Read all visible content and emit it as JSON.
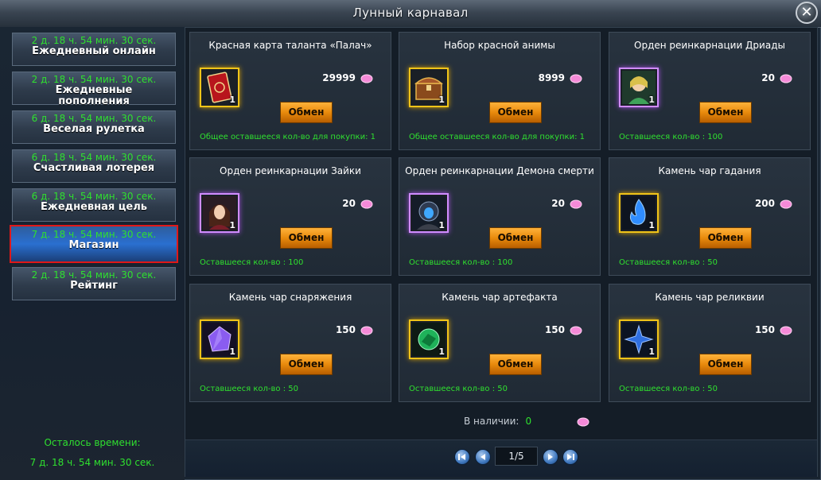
{
  "window": {
    "title": "Лунный карнавал",
    "close_symbol": "✕"
  },
  "sidebar": {
    "tabs": [
      {
        "timer": "2 д. 18 ч. 54 мин. 30 сек.",
        "label": "Ежедневный онлайн"
      },
      {
        "timer": "2 д. 18 ч. 54 мин. 30 сек.",
        "label": "Ежедневные пополнения"
      },
      {
        "timer": "6 д. 18 ч. 54 мин. 30 сек.",
        "label": "Веселая рулетка"
      },
      {
        "timer": "6 д. 18 ч. 54 мин. 30 сек.",
        "label": "Счастливая лотерея"
      },
      {
        "timer": "6 д. 18 ч. 54 мин. 30 сек.",
        "label": "Ежедневная цель"
      },
      {
        "timer": "7 д. 18 ч. 54 мин. 30 сек.",
        "label": "Магазин",
        "active": true
      },
      {
        "timer": "2 д. 18 ч. 54 мин. 30 сек.",
        "label": "Рейтинг"
      }
    ],
    "remaining_label": "Осталось времени:",
    "remaining_value": "7 д. 18 ч. 54 мин. 30 сек."
  },
  "shop": {
    "exchange_label": "Обмен",
    "items": [
      {
        "name": "Красная карта таланта «Палач»",
        "price": "29999",
        "qty": "1",
        "frame": "gold",
        "icon": "red-talent-card-icon",
        "stock": "Общее оставшееся кол-во для покупки: 1"
      },
      {
        "name": "Набор красной анимы",
        "price": "8999",
        "qty": "1",
        "frame": "gold",
        "icon": "treasure-chest-icon",
        "stock": "Общее оставшееся кол-во для покупки: 1"
      },
      {
        "name": "Орден реинкарнации Дриады",
        "price": "20",
        "qty": "1",
        "frame": "purple",
        "icon": "dryad-portrait-icon",
        "stock": "Оставшееся кол-во : 100"
      },
      {
        "name": "Орден реинкарнации Зайки",
        "price": "20",
        "qty": "1",
        "frame": "purple",
        "icon": "bunny-portrait-icon",
        "stock": "Оставшееся кол-во : 100"
      },
      {
        "name": "Орден реинкарнации Демона смерти",
        "price": "20",
        "qty": "1",
        "frame": "purple",
        "icon": "death-demon-portrait-icon",
        "stock": "Оставшееся кол-во : 100"
      },
      {
        "name": "Камень чар гадания",
        "price": "200",
        "qty": "1",
        "frame": "gold",
        "icon": "blue-flame-stone-icon",
        "stock": "Оставшееся кол-во : 50"
      },
      {
        "name": "Камень чар снаряжения",
        "price": "150",
        "qty": "1",
        "frame": "gold",
        "icon": "purple-crystal-stone-icon",
        "stock": "Оставшееся кол-во : 50"
      },
      {
        "name": "Камень чар артефакта",
        "price": "150",
        "qty": "1",
        "frame": "gold",
        "icon": "green-crystal-stone-icon",
        "stock": "Оставшееся кол-во : 50"
      },
      {
        "name": "Камень чар реликвии",
        "price": "150",
        "qty": "1",
        "frame": "gold",
        "icon": "blue-star-stone-icon",
        "stock": "Оставшееся кол-во : 50"
      }
    ],
    "available_label": "В наличии:",
    "available_value": "0",
    "currency_icon": "pink-gem-icon"
  },
  "pager": {
    "page": "1/5"
  },
  "colors": {
    "timer_green": "#2fe02f",
    "exchange_orange": "#e88a0c",
    "active_tab_border": "#e01818",
    "gold_frame": "#f0c419",
    "purple_frame": "#d08cff"
  }
}
